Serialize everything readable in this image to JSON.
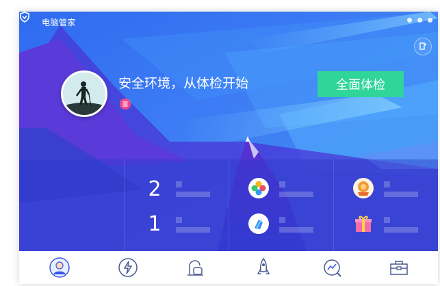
{
  "window": {
    "title": "电脑管家"
  },
  "header": {
    "headline": "安全环境，从体检开始",
    "scan_button": "全面体检"
  },
  "stats": {
    "first": "2",
    "second": "1"
  },
  "colors": {
    "scan_button": "#2fd59b",
    "accent": "#3a54e8",
    "sky_top": "#2f6bf0"
  },
  "icons": {
    "badges": [
      "shield-icon",
      "coin-icon",
      "list-icon"
    ],
    "tools": [
      "color-wheel-icon",
      "clean-tool-icon",
      "medal-100-icon",
      "gift-box-icon"
    ],
    "nav": [
      "user-icon",
      "speed-icon",
      "vacuum-icon",
      "rocket-icon",
      "chart-icon",
      "toolbox-icon"
    ]
  }
}
